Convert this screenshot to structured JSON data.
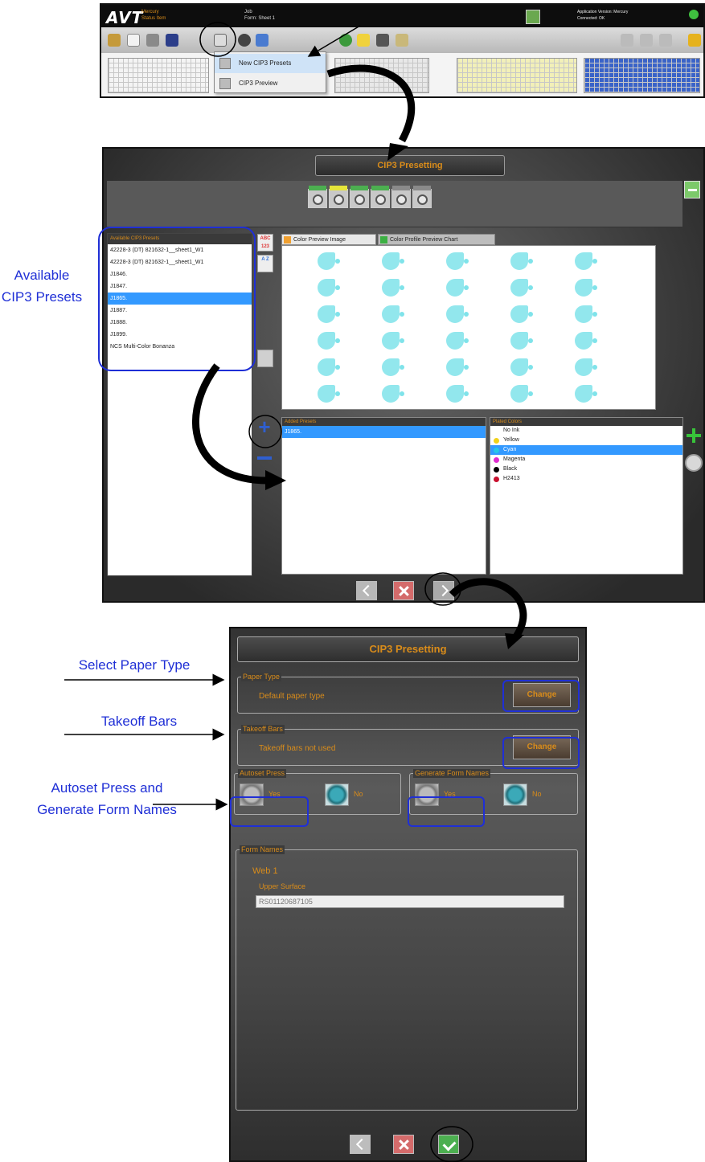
{
  "top": {
    "logo": "AVT",
    "status_line1": "Mercury",
    "status_line2": "Status Item",
    "info_line1": "Job",
    "info_line2": "Form: Sheet 1",
    "app_line1": "Application Version: Mercury",
    "app_line2": "Connected: OK",
    "dropdown_items": [
      "New CIP3 Presets",
      "CIP3 Preview"
    ]
  },
  "mid": {
    "title": "CIP3 Presetting",
    "units": [
      "Unit 1",
      "Unit 2",
      "Unit 3",
      "Unit 4",
      "Unit 5",
      "Unit 6"
    ],
    "presets_header": "Available CIP3 Presets",
    "presets": [
      "42228-3 (DT) 821632-1__sheet1_W1",
      "42228-3 (DT) 821632-1__sheet1_W1",
      "J1846.",
      "J1847.",
      "J1865.",
      "J1887.",
      "J1888.",
      "J1899.",
      "NCS Multi-Color Bonanza"
    ],
    "selected_preset_index": 4,
    "sort_abc_label": "ABC 123",
    "sort_az_label": "A Z",
    "tab_image": "Color Preview Image",
    "tab_chart": "Color Profile Preview Chart",
    "added_header": "Added Presets",
    "added_presets": [
      "J1865."
    ],
    "plate_header": "Plated Colors",
    "plate_colors": [
      {
        "name": "No Ink",
        "color": "#ffffff"
      },
      {
        "name": "Yellow",
        "color": "#f2d21b"
      },
      {
        "name": "Cyan",
        "color": "#27c6e8"
      },
      {
        "name": "Magenta",
        "color": "#e02bd0"
      },
      {
        "name": "Black",
        "color": "#000000"
      },
      {
        "name": "H2413",
        "color": "#c8102e"
      }
    ],
    "selected_plate_index": 2
  },
  "bottom": {
    "title": "CIP3 Presetting",
    "paper_type_label": "Paper Type",
    "paper_type_value": "Default paper type",
    "change_label": "Change",
    "takeoff_label": "Takeoff Bars",
    "takeoff_value": "Takeoff bars not used",
    "autoset_label": "Autoset Press",
    "genform_label": "Generate Form Names",
    "yes_label": "Yes",
    "no_label": "No",
    "form_names_label": "Form Names",
    "web_label": "Web 1",
    "surface_label": "Upper Surface",
    "form_name_value": "RS01120687105"
  },
  "annotations": {
    "available_presets": "Available CIP3 Presets",
    "select_paper": "Select Paper Type",
    "takeoff_bars": "Takeoff Bars",
    "autoset": "Autoset Press and Generate Form Names"
  },
  "colors": {
    "accent_orange": "#d98c1a",
    "annotation_blue": "#1f2fd6",
    "selection_blue": "#3399ff",
    "preview_cyan": "#7fe3ea"
  }
}
